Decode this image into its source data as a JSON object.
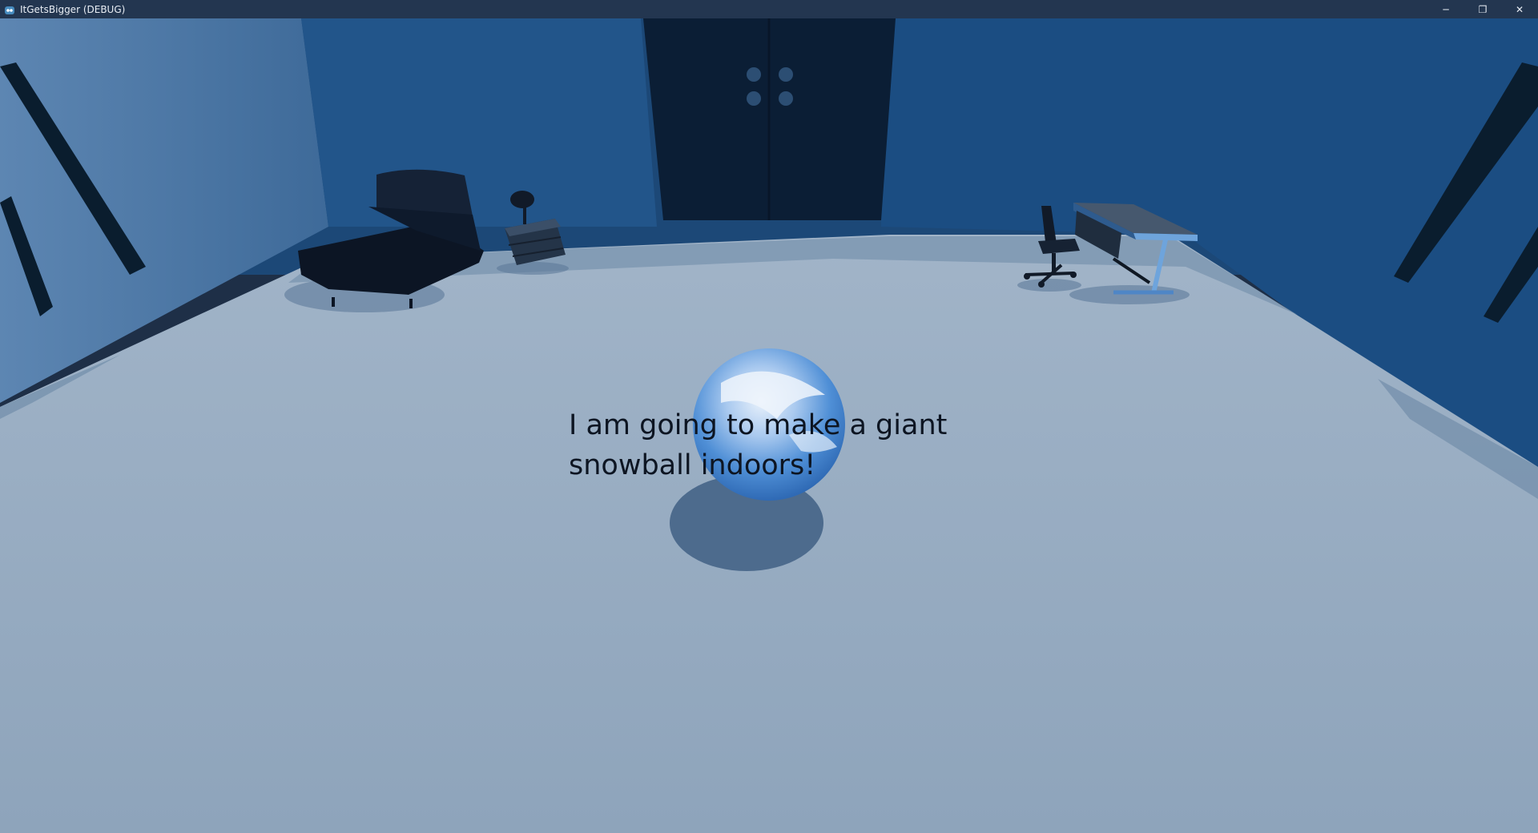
{
  "window": {
    "title": "ItGetsBigger (DEBUG)",
    "icon": "godot-engine-icon",
    "controls": {
      "minimize_glyph": "─",
      "restore_glyph": "❐",
      "close_glyph": "✕"
    }
  },
  "scene": {
    "dialogue_text": "I am going to make a giant\nsnowball indoors!",
    "objects": [
      "bed",
      "nightstand-lamp",
      "double-door",
      "desk",
      "office-chair",
      "snowball",
      "windows"
    ]
  },
  "colors": {
    "titlebar": "#233650",
    "wall": "#1c4877",
    "floor": "#8fa5bd",
    "door": "#0b1e35",
    "snowball": "#4f8fd6",
    "text": "#0d1522"
  }
}
